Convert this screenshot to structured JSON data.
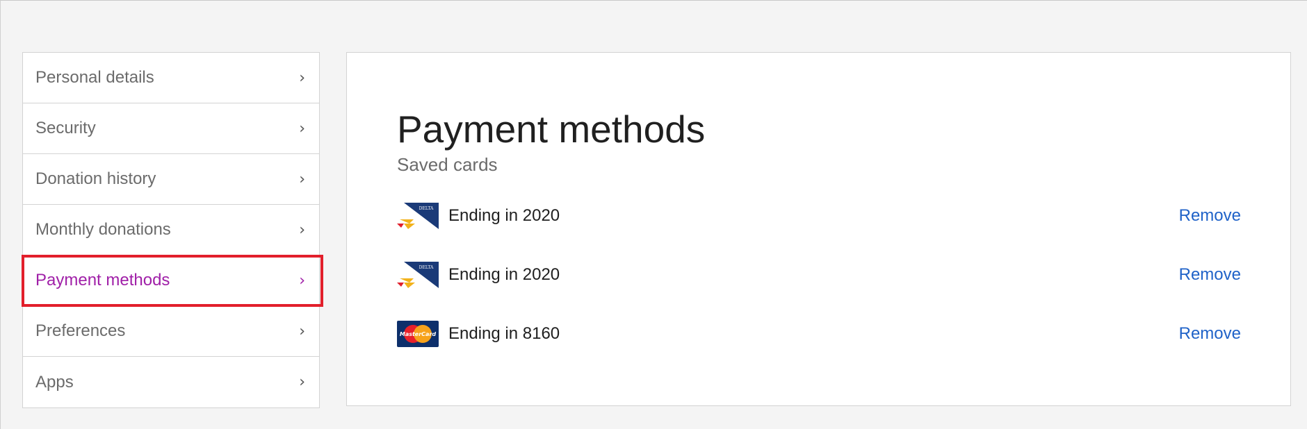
{
  "sidebar": {
    "items": [
      {
        "label": "Personal details",
        "chevron": "›"
      },
      {
        "label": "Security",
        "chevron": "›"
      },
      {
        "label": "Donation history",
        "chevron": "›"
      },
      {
        "label": "Monthly donations",
        "chevron": "›"
      },
      {
        "label": "Payment methods",
        "chevron": "›",
        "active": true
      },
      {
        "label": "Preferences",
        "chevron": "›"
      },
      {
        "label": "Apps",
        "chevron": "›"
      }
    ]
  },
  "main": {
    "title": "Payment methods",
    "subtitle": "Saved cards",
    "cards": [
      {
        "brand_icon": "delta-card-icon",
        "text": "Ending in 2020",
        "action": "Remove"
      },
      {
        "brand_icon": "delta-card-icon",
        "text": "Ending in 2020",
        "action": "Remove"
      },
      {
        "brand_icon": "mastercard-icon",
        "text": "Ending in 8160",
        "action": "Remove",
        "brand_label": "MasterCard"
      }
    ]
  },
  "colors": {
    "active_nav": "#a020a8",
    "highlight_box": "#e21f2b",
    "link": "#1f62c8",
    "background": "#f4f4f4"
  }
}
